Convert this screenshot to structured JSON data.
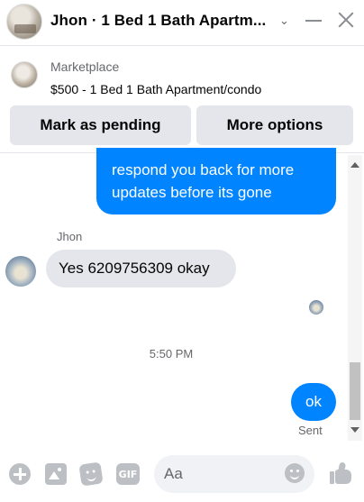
{
  "header": {
    "title": "Jhon · 1 Bed 1 Bath Apartm...",
    "icons": [
      "avatar",
      "chevron-down-icon",
      "minimize-icon",
      "close-icon"
    ]
  },
  "marketplace": {
    "label": "Marketplace",
    "listing": "$500 - 1 Bed 1 Bath Apartment/condo",
    "buttons": {
      "pending": "Mark as pending",
      "more": "More options"
    }
  },
  "messages": {
    "outgoing_partial": "respond you back for more updates before its gone",
    "sender_name": "Jhon",
    "incoming": "Yes 6209756309 okay",
    "timestamp": "5:50 PM",
    "outgoing_last": "ok",
    "status": "Sent"
  },
  "composer": {
    "placeholder": "Aa",
    "icons": [
      "plus-icon",
      "image-icon",
      "sticker-icon",
      "gif-icon",
      "emoji-icon",
      "like-icon"
    ],
    "gif_label": "GIF"
  },
  "colors": {
    "accent": "#0084ff",
    "bubble_incoming": "#e4e6eb",
    "icon_gray": "#bcc0c4"
  }
}
